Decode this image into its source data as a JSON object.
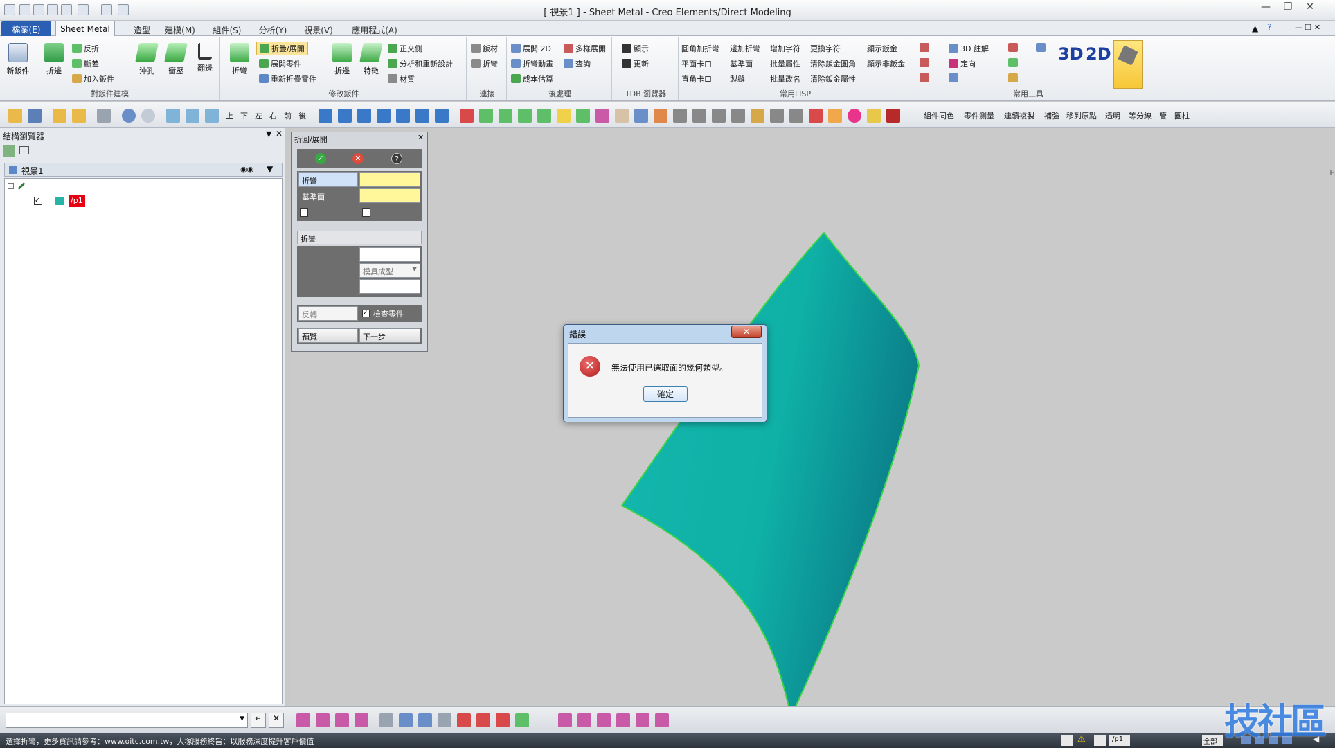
{
  "window": {
    "title": "[ 視景1 ] - Sheet Metal - Creo Elements/Direct Modeling"
  },
  "menu": {
    "file": "檔案(E)",
    "tabs": [
      "Sheet Metal",
      "造型",
      "建模(M)",
      "組件(S)",
      "分析(Y)",
      "視景(V)",
      "應用程式(A)"
    ]
  },
  "ribbon": {
    "groups": [
      {
        "name": "對鈑件建模",
        "items": [
          "新鈑件",
          "折邊",
          "反折",
          "斷差",
          "加入鈑件",
          "沖孔",
          "衝壓",
          "翻邊"
        ]
      },
      {
        "name": "修改鈑件",
        "items": [
          "折彎",
          "折疊/展開",
          "展開零件",
          "重新折疊零件",
          "折邊",
          "特徵",
          "正交側",
          "分析和重新設計",
          "材質"
        ]
      },
      {
        "name": "連接",
        "items": [
          "鈑材",
          "折彎"
        ]
      },
      {
        "name": "後處理",
        "items": [
          "展開 2D",
          "多樣展開",
          "折彎動畫",
          "查詢",
          "成本估算"
        ]
      },
      {
        "name": "TDB 瀏覽器",
        "items": [
          "顯示",
          "更新"
        ]
      },
      {
        "name": "常用LISP",
        "items": [
          "圓角加折彎",
          "邊加折彎",
          "增加字符",
          "更換字符",
          "顯示鈑金",
          "平面卡口",
          "基準面",
          "批量屬性",
          "清除鈑金圓角",
          "顯示非鈑金",
          "直角卡口",
          "製縫",
          "批量改名",
          "清除鈑金屬性"
        ]
      },
      {
        "name": "常用工具",
        "items": [
          "3D 註解",
          "定向",
          "3D",
          "2D"
        ]
      }
    ]
  },
  "toolbar2": {
    "view_labels": [
      "上",
      "下",
      "左",
      "右",
      "前",
      "後"
    ],
    "right_labels": [
      "組件同色",
      "零件測量",
      "連續複製",
      "補強",
      "移到原點",
      "透明",
      "等分線",
      "管",
      "圓柱"
    ]
  },
  "browser": {
    "title": "結構瀏覽器",
    "view_name": "視景1",
    "part_label": "/p1"
  },
  "fold_dialog": {
    "title": "折回/展開",
    "field_bend": "折彎",
    "field_base": "基準面",
    "section_bend": "折彎",
    "select_value": "模具成型",
    "reverse": "反轉",
    "check_part": "檢查零件",
    "preview": "預覽",
    "next": "下一步"
  },
  "error_dialog": {
    "title": "錯誤",
    "message": "無法使用已選取面的幾何類型。",
    "ok": "確定"
  },
  "status": {
    "message": "選擇折彎，更多資訊請參考：www.oitc.com.tw，大塚服務終旨：以服務深度提升客戶價值",
    "part": "/p1",
    "filter": "全部"
  },
  "watermark": "技社區",
  "colors": {
    "sheet_fill": "#0fb3aa",
    "sheet_edge": "#3ad648",
    "accent": "#2a5fb3",
    "error_red": "#c8232a"
  }
}
